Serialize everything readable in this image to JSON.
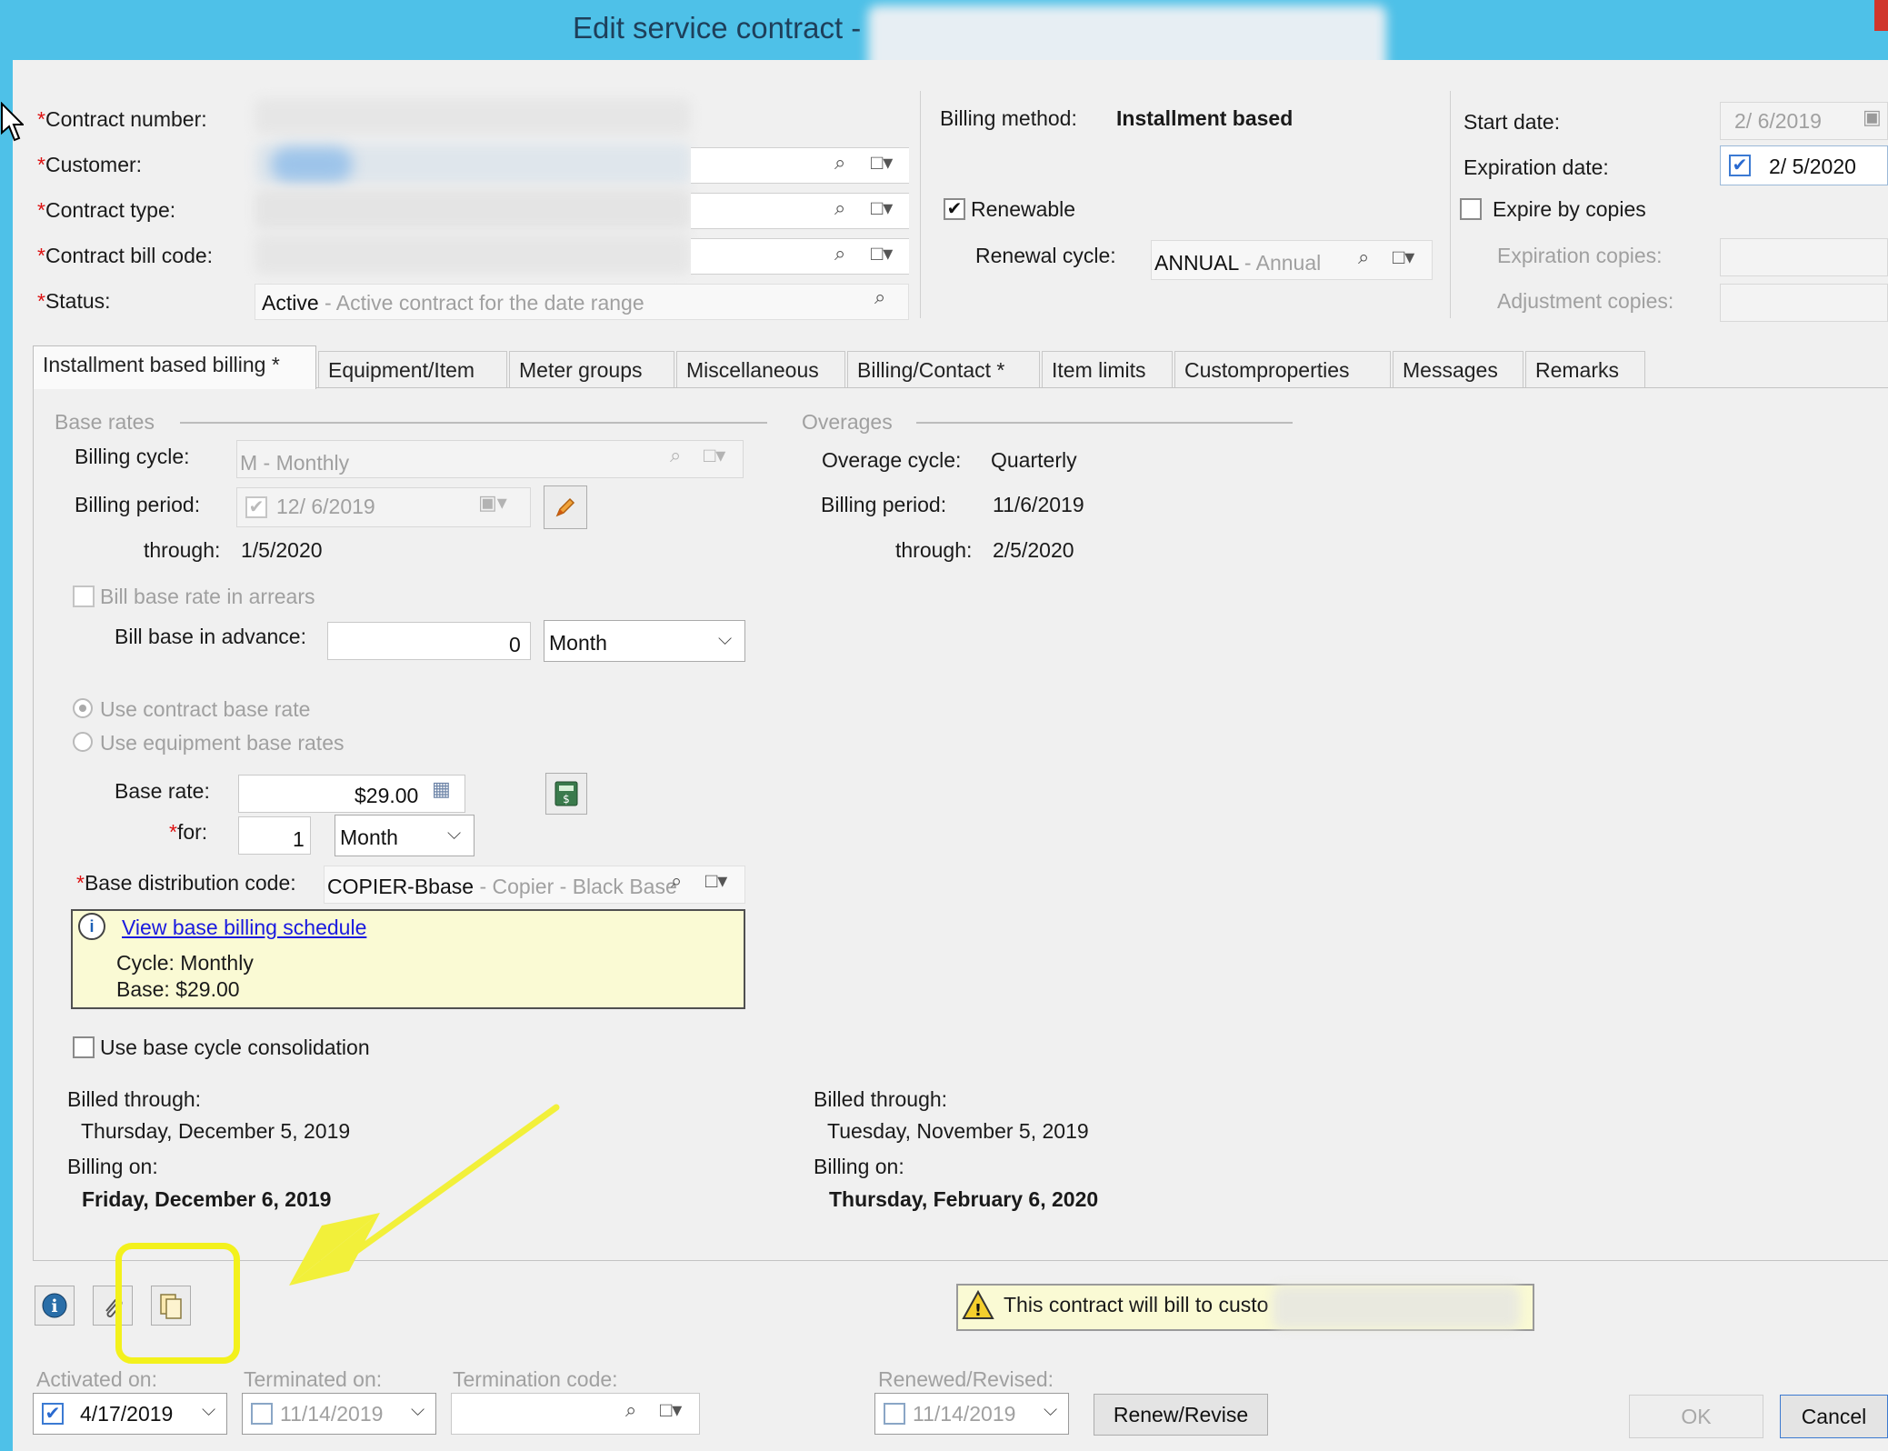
{
  "window": {
    "title": "Edit service contract -"
  },
  "header": {
    "contract_number_label": "Contract number:",
    "customer_label": "Customer:",
    "contract_type_label": "Contract type:",
    "contract_bill_code_label": "Contract bill code:",
    "status_label": "Status:",
    "status_value": "Active",
    "status_desc": " - Active contract for the date range",
    "billing_method_label": "Billing method:",
    "billing_method_value": "Installment based",
    "renewable_label": "Renewable",
    "renewable_checked": true,
    "renewal_cycle_label": "Renewal cycle:",
    "renewal_cycle_value": "ANNUAL",
    "renewal_cycle_desc": " - Annual",
    "start_date_label": "Start date:",
    "start_date_value": "2/ 6/2019",
    "expiration_date_label": "Expiration date:",
    "expiration_date_value": "2/ 5/2020",
    "expire_by_copies_label": "Expire by copies",
    "expiration_copies_label": "Expiration copies:",
    "adjustment_copies_label": "Adjustment copies:"
  },
  "tabs": [
    {
      "label": "Installment based billing *",
      "active": true
    },
    {
      "label": "Equipment/Item"
    },
    {
      "label": "Meter groups"
    },
    {
      "label": "Miscellaneous"
    },
    {
      "label": "Billing/Contact *"
    },
    {
      "label": "Item limits"
    },
    {
      "label": "Customproperties"
    },
    {
      "label": "Messages"
    },
    {
      "label": "Remarks"
    }
  ],
  "base": {
    "section_title": "Base rates",
    "billing_cycle_label": "Billing cycle:",
    "billing_cycle_value": "M - Monthly",
    "billing_period_label": "Billing period:",
    "billing_period_value": "12/ 6/2019",
    "through_label": "through:",
    "through_value": "1/5/2020",
    "bill_in_arrears_label": "Bill base rate in arrears",
    "bill_in_advance_label": "Bill base in advance:",
    "bill_in_advance_value": "0",
    "bill_in_advance_unit": "Month",
    "use_contract_rate_label": "Use contract base rate",
    "use_equipment_rates_label": "Use equipment base rates",
    "base_rate_label": "Base rate:",
    "base_rate_value": "$29.00",
    "for_label": "for:",
    "for_value": "1",
    "for_unit": "Month",
    "distribution_code_label": "Base distribution code:",
    "distribution_code_value": "COPIER-Bbase",
    "distribution_code_desc": " - Copier - Black Base",
    "schedule_link": "View base billing schedule",
    "schedule_cycle": "Cycle: Monthly",
    "schedule_base": "Base: $29.00",
    "consolidation_label": "Use base cycle consolidation",
    "billed_through_label": "Billed through:",
    "billed_through_value": "Thursday, December 5, 2019",
    "billing_on_label": "Billing on:",
    "billing_on_value": "Friday, December 6, 2019"
  },
  "overages": {
    "section_title": "Overages",
    "cycle_label": "Overage cycle:",
    "cycle_value": "Quarterly",
    "billing_period_label": "Billing period:",
    "billing_period_value": "11/6/2019",
    "through_label": "through:",
    "through_value": "2/5/2020",
    "billed_through_label": "Billed through:",
    "billed_through_value": "Tuesday, November 5, 2019",
    "billing_on_label": "Billing on:",
    "billing_on_value": "Thursday, February 6, 2020"
  },
  "footer": {
    "warning_text": "This contract will bill to custo",
    "activated_on_label": "Activated on:",
    "activated_on_value": "4/17/2019",
    "terminated_on_label": "Terminated on:",
    "terminated_on_value": "11/14/2019",
    "termination_code_label": "Termination code:",
    "renewed_revised_label": "Renewed/Revised:",
    "renewed_revised_value": "11/14/2019",
    "renew_revise_button": "Renew/Revise",
    "ok_button": "OK",
    "cancel_button": "Cancel"
  },
  "annotation": {
    "highlight_color": "#f3f11c",
    "arrow_color": "#f2f03a"
  }
}
